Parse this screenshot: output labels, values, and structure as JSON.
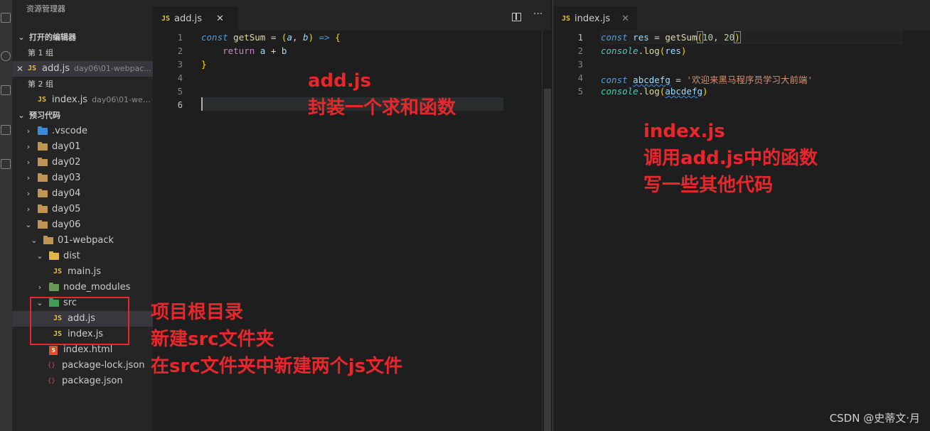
{
  "sidebar": {
    "title": "资源管理器",
    "open_editors_label": "打开的编辑器",
    "group1_label": "第 1 组",
    "group2_label": "第 2 组",
    "open_editors": [
      {
        "name": "add.js",
        "desc": "day06\\01-webpac..."
      },
      {
        "name": "index.js",
        "desc": "day06\\01-webp..."
      }
    ],
    "project_label": "预习代码",
    "tree": {
      "vscode": ".vscode",
      "day01": "day01",
      "day02": "day02",
      "day03": "day03",
      "day04": "day04",
      "day05": "day05",
      "day06": "day06",
      "webpack": "01-webpack",
      "dist": "dist",
      "mainjs": "main.js",
      "node_modules": "node_modules",
      "src": "src",
      "addjs": "add.js",
      "indexjs": "index.js",
      "indexhtml": "index.html",
      "pkglock": "package-lock.json",
      "pkg": "package.json"
    }
  },
  "icons": {
    "js": "JS",
    "html": "5",
    "json": "{}"
  },
  "editor_left": {
    "tab_label": "add.js",
    "line_numbers": [
      "1",
      "2",
      "3",
      "4",
      "5",
      "6"
    ]
  },
  "editor_right": {
    "tab_label": "index.js",
    "line_numbers": [
      "1",
      "2",
      "3",
      "4",
      "5"
    ],
    "string_value": "'欢迎来黑马程序员学习大前端'"
  },
  "annotations": {
    "left_line1": "add.js",
    "left_line2": "封装一个求和函数",
    "right_line1": "index.js",
    "right_line2": "调用add.js中的函数",
    "right_line3": "写一些其他代码",
    "sidebar_line1": "项目根目录",
    "sidebar_line2": "新建src文件夹",
    "sidebar_line3": "在src文件夹中新建两个js文件"
  },
  "watermark": "CSDN @史蒂文·月",
  "colors": {
    "annotation_red": "#e8272d",
    "js_yellow": "#e8c238",
    "editor_bg": "#1e1e1e"
  }
}
